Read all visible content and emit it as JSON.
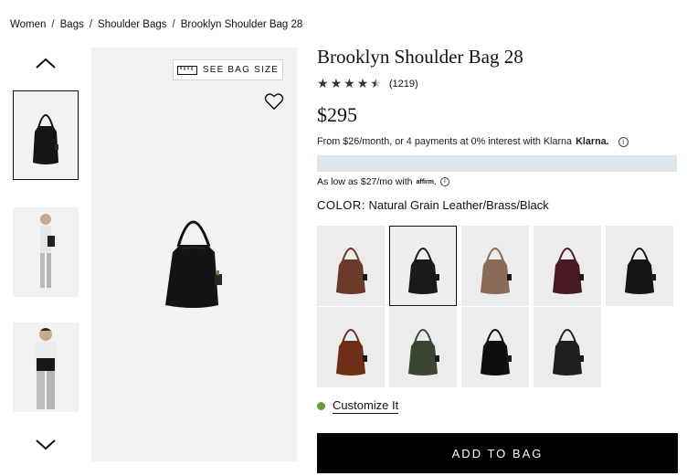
{
  "breadcrumb": [
    "Women",
    "Bags",
    "Shoulder Bags",
    "Brooklyn Shoulder Bag 28"
  ],
  "gallery": {
    "size_button_label": "SEE BAG SIZE",
    "thumbnails": [
      "bag-front",
      "model-side",
      "model-front"
    ]
  },
  "product": {
    "title": "Brooklyn Shoulder Bag 28",
    "rating_stars": 4.5,
    "rating_count": "(1219)",
    "price": "$295",
    "klarna_text": "From $26/month, or 4 payments at 0% interest with Klarna",
    "klarna_brand": "Klarna.",
    "affirm_text": "As low as $27/mo with",
    "affirm_brand": "affirm",
    "affirm_suffix": ".",
    "color_label": "COLOR:",
    "color_value": "Natural Grain Leather/Brass/Black",
    "customize_label": "Customize It",
    "add_to_bag_label": "ADD TO BAG"
  },
  "swatches": [
    {
      "color": "#6b3a2a"
    },
    {
      "color": "#1a1a1a",
      "selected": true
    },
    {
      "color": "#8a6a58"
    },
    {
      "color": "#4a1a24"
    },
    {
      "color": "#161616"
    },
    {
      "color": "#6e2e18"
    },
    {
      "color": "#3a4632"
    },
    {
      "color": "#0f0f0f"
    },
    {
      "color": "#1e1e1e"
    }
  ],
  "colors": {
    "promo_bar": "#dde5ec",
    "customize_dot": "#6b9b3a"
  }
}
